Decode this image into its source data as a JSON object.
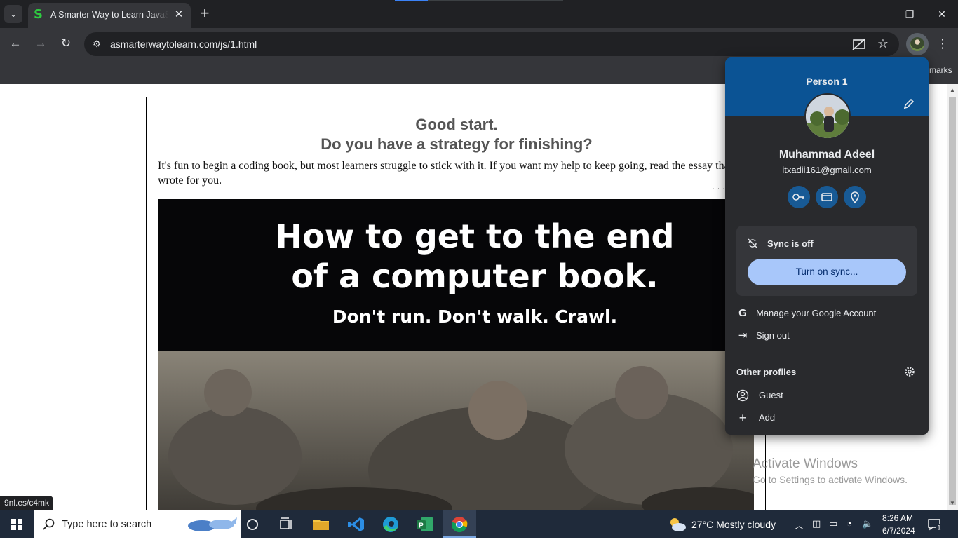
{
  "browser": {
    "tab": {
      "title": "A Smarter Way to Learn JavaScript",
      "favicon": "S"
    },
    "url": "asmarterwaytolearn.com/js/1.html",
    "bookmarks_label": "marks",
    "status_url": "9nl.es/c4mk"
  },
  "page": {
    "heading_line1": "Good start.",
    "heading_line2": "Do you have a strategy for finishing?",
    "intro": "It's fun to begin a coding book, but most learners struggle to stick with it. If you want my help to keep going, read the essay that I wrote for you.",
    "banner_line1": "How to get to the end",
    "banner_line2": "of a computer book.",
    "banner_line3": "Don't run. Don't walk. Crawl.",
    "dotted_marker": "· · · · · ·"
  },
  "profile_popup": {
    "header": "Person 1",
    "name": "Muhammad Adeel",
    "email": "itxadii161@gmail.com",
    "quick_icons": [
      "key-icon",
      "card-icon",
      "location-icon"
    ],
    "sync_status": "Sync is off",
    "sync_button": "Turn on sync...",
    "manage_account": "Manage your Google Account",
    "sign_out": "Sign out",
    "other_profiles": "Other profiles",
    "guest": "Guest",
    "add": "Add",
    "header_color": "#0b5394",
    "sync_button_color": "#a8c7fa"
  },
  "watermark": {
    "line1": "Activate Windows",
    "line2": "Go to Settings to activate Windows."
  },
  "taskbar": {
    "search_placeholder": "Type here to search",
    "weather": "27°C  Mostly cloudy",
    "time": "8:26 AM",
    "date": "6/7/2024",
    "notifications": "1",
    "apps": [
      "cortana-icon",
      "task-view-icon",
      "file-explorer-icon",
      "vscode-icon",
      "edge-icon",
      "project-icon",
      "chrome-icon"
    ]
  }
}
